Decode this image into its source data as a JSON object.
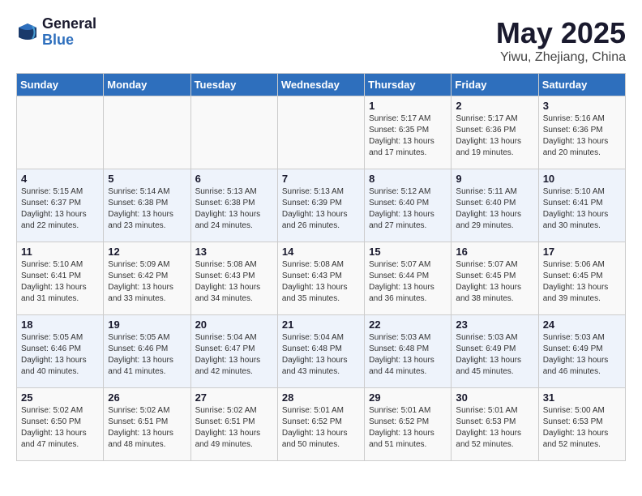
{
  "header": {
    "logo_general": "General",
    "logo_blue": "Blue",
    "month_year": "May 2025",
    "location": "Yiwu, Zhejiang, China"
  },
  "weekdays": [
    "Sunday",
    "Monday",
    "Tuesday",
    "Wednesday",
    "Thursday",
    "Friday",
    "Saturday"
  ],
  "weeks": [
    [
      {
        "day": "",
        "detail": ""
      },
      {
        "day": "",
        "detail": ""
      },
      {
        "day": "",
        "detail": ""
      },
      {
        "day": "",
        "detail": ""
      },
      {
        "day": "1",
        "detail": "Sunrise: 5:17 AM\nSunset: 6:35 PM\nDaylight: 13 hours\nand 17 minutes."
      },
      {
        "day": "2",
        "detail": "Sunrise: 5:17 AM\nSunset: 6:36 PM\nDaylight: 13 hours\nand 19 minutes."
      },
      {
        "day": "3",
        "detail": "Sunrise: 5:16 AM\nSunset: 6:36 PM\nDaylight: 13 hours\nand 20 minutes."
      }
    ],
    [
      {
        "day": "4",
        "detail": "Sunrise: 5:15 AM\nSunset: 6:37 PM\nDaylight: 13 hours\nand 22 minutes."
      },
      {
        "day": "5",
        "detail": "Sunrise: 5:14 AM\nSunset: 6:38 PM\nDaylight: 13 hours\nand 23 minutes."
      },
      {
        "day": "6",
        "detail": "Sunrise: 5:13 AM\nSunset: 6:38 PM\nDaylight: 13 hours\nand 24 minutes."
      },
      {
        "day": "7",
        "detail": "Sunrise: 5:13 AM\nSunset: 6:39 PM\nDaylight: 13 hours\nand 26 minutes."
      },
      {
        "day": "8",
        "detail": "Sunrise: 5:12 AM\nSunset: 6:40 PM\nDaylight: 13 hours\nand 27 minutes."
      },
      {
        "day": "9",
        "detail": "Sunrise: 5:11 AM\nSunset: 6:40 PM\nDaylight: 13 hours\nand 29 minutes."
      },
      {
        "day": "10",
        "detail": "Sunrise: 5:10 AM\nSunset: 6:41 PM\nDaylight: 13 hours\nand 30 minutes."
      }
    ],
    [
      {
        "day": "11",
        "detail": "Sunrise: 5:10 AM\nSunset: 6:41 PM\nDaylight: 13 hours\nand 31 minutes."
      },
      {
        "day": "12",
        "detail": "Sunrise: 5:09 AM\nSunset: 6:42 PM\nDaylight: 13 hours\nand 33 minutes."
      },
      {
        "day": "13",
        "detail": "Sunrise: 5:08 AM\nSunset: 6:43 PM\nDaylight: 13 hours\nand 34 minutes."
      },
      {
        "day": "14",
        "detail": "Sunrise: 5:08 AM\nSunset: 6:43 PM\nDaylight: 13 hours\nand 35 minutes."
      },
      {
        "day": "15",
        "detail": "Sunrise: 5:07 AM\nSunset: 6:44 PM\nDaylight: 13 hours\nand 36 minutes."
      },
      {
        "day": "16",
        "detail": "Sunrise: 5:07 AM\nSunset: 6:45 PM\nDaylight: 13 hours\nand 38 minutes."
      },
      {
        "day": "17",
        "detail": "Sunrise: 5:06 AM\nSunset: 6:45 PM\nDaylight: 13 hours\nand 39 minutes."
      }
    ],
    [
      {
        "day": "18",
        "detail": "Sunrise: 5:05 AM\nSunset: 6:46 PM\nDaylight: 13 hours\nand 40 minutes."
      },
      {
        "day": "19",
        "detail": "Sunrise: 5:05 AM\nSunset: 6:46 PM\nDaylight: 13 hours\nand 41 minutes."
      },
      {
        "day": "20",
        "detail": "Sunrise: 5:04 AM\nSunset: 6:47 PM\nDaylight: 13 hours\nand 42 minutes."
      },
      {
        "day": "21",
        "detail": "Sunrise: 5:04 AM\nSunset: 6:48 PM\nDaylight: 13 hours\nand 43 minutes."
      },
      {
        "day": "22",
        "detail": "Sunrise: 5:03 AM\nSunset: 6:48 PM\nDaylight: 13 hours\nand 44 minutes."
      },
      {
        "day": "23",
        "detail": "Sunrise: 5:03 AM\nSunset: 6:49 PM\nDaylight: 13 hours\nand 45 minutes."
      },
      {
        "day": "24",
        "detail": "Sunrise: 5:03 AM\nSunset: 6:49 PM\nDaylight: 13 hours\nand 46 minutes."
      }
    ],
    [
      {
        "day": "25",
        "detail": "Sunrise: 5:02 AM\nSunset: 6:50 PM\nDaylight: 13 hours\nand 47 minutes."
      },
      {
        "day": "26",
        "detail": "Sunrise: 5:02 AM\nSunset: 6:51 PM\nDaylight: 13 hours\nand 48 minutes."
      },
      {
        "day": "27",
        "detail": "Sunrise: 5:02 AM\nSunset: 6:51 PM\nDaylight: 13 hours\nand 49 minutes."
      },
      {
        "day": "28",
        "detail": "Sunrise: 5:01 AM\nSunset: 6:52 PM\nDaylight: 13 hours\nand 50 minutes."
      },
      {
        "day": "29",
        "detail": "Sunrise: 5:01 AM\nSunset: 6:52 PM\nDaylight: 13 hours\nand 51 minutes."
      },
      {
        "day": "30",
        "detail": "Sunrise: 5:01 AM\nSunset: 6:53 PM\nDaylight: 13 hours\nand 52 minutes."
      },
      {
        "day": "31",
        "detail": "Sunrise: 5:00 AM\nSunset: 6:53 PM\nDaylight: 13 hours\nand 52 minutes."
      }
    ]
  ]
}
